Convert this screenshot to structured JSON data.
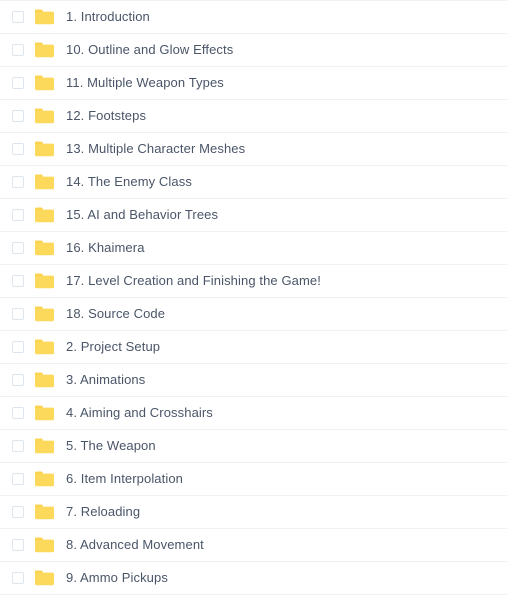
{
  "colors": {
    "row_separator": "#eef2f7",
    "checkbox_border": "#dfe5ed",
    "folder_body": "#fcd95b",
    "folder_tab": "#fbd34d",
    "text": "#4a5568",
    "background": "#ffffff"
  },
  "icons": {
    "folder": "folder-icon",
    "checkbox": "row-checkbox"
  },
  "list": {
    "rows": [
      {
        "label": "1. Introduction"
      },
      {
        "label": "10. Outline and Glow Effects"
      },
      {
        "label": "11. Multiple Weapon Types"
      },
      {
        "label": "12. Footsteps"
      },
      {
        "label": "13. Multiple Character Meshes"
      },
      {
        "label": "14. The Enemy Class"
      },
      {
        "label": "15. AI and Behavior Trees"
      },
      {
        "label": "16. Khaimera"
      },
      {
        "label": "17. Level Creation and Finishing the Game!"
      },
      {
        "label": "18. Source Code"
      },
      {
        "label": "2. Project Setup"
      },
      {
        "label": "3. Animations"
      },
      {
        "label": "4. Aiming and Crosshairs"
      },
      {
        "label": "5. The Weapon"
      },
      {
        "label": "6. Item Interpolation"
      },
      {
        "label": "7. Reloading"
      },
      {
        "label": "8. Advanced Movement"
      },
      {
        "label": "9. Ammo Pickups"
      }
    ]
  }
}
